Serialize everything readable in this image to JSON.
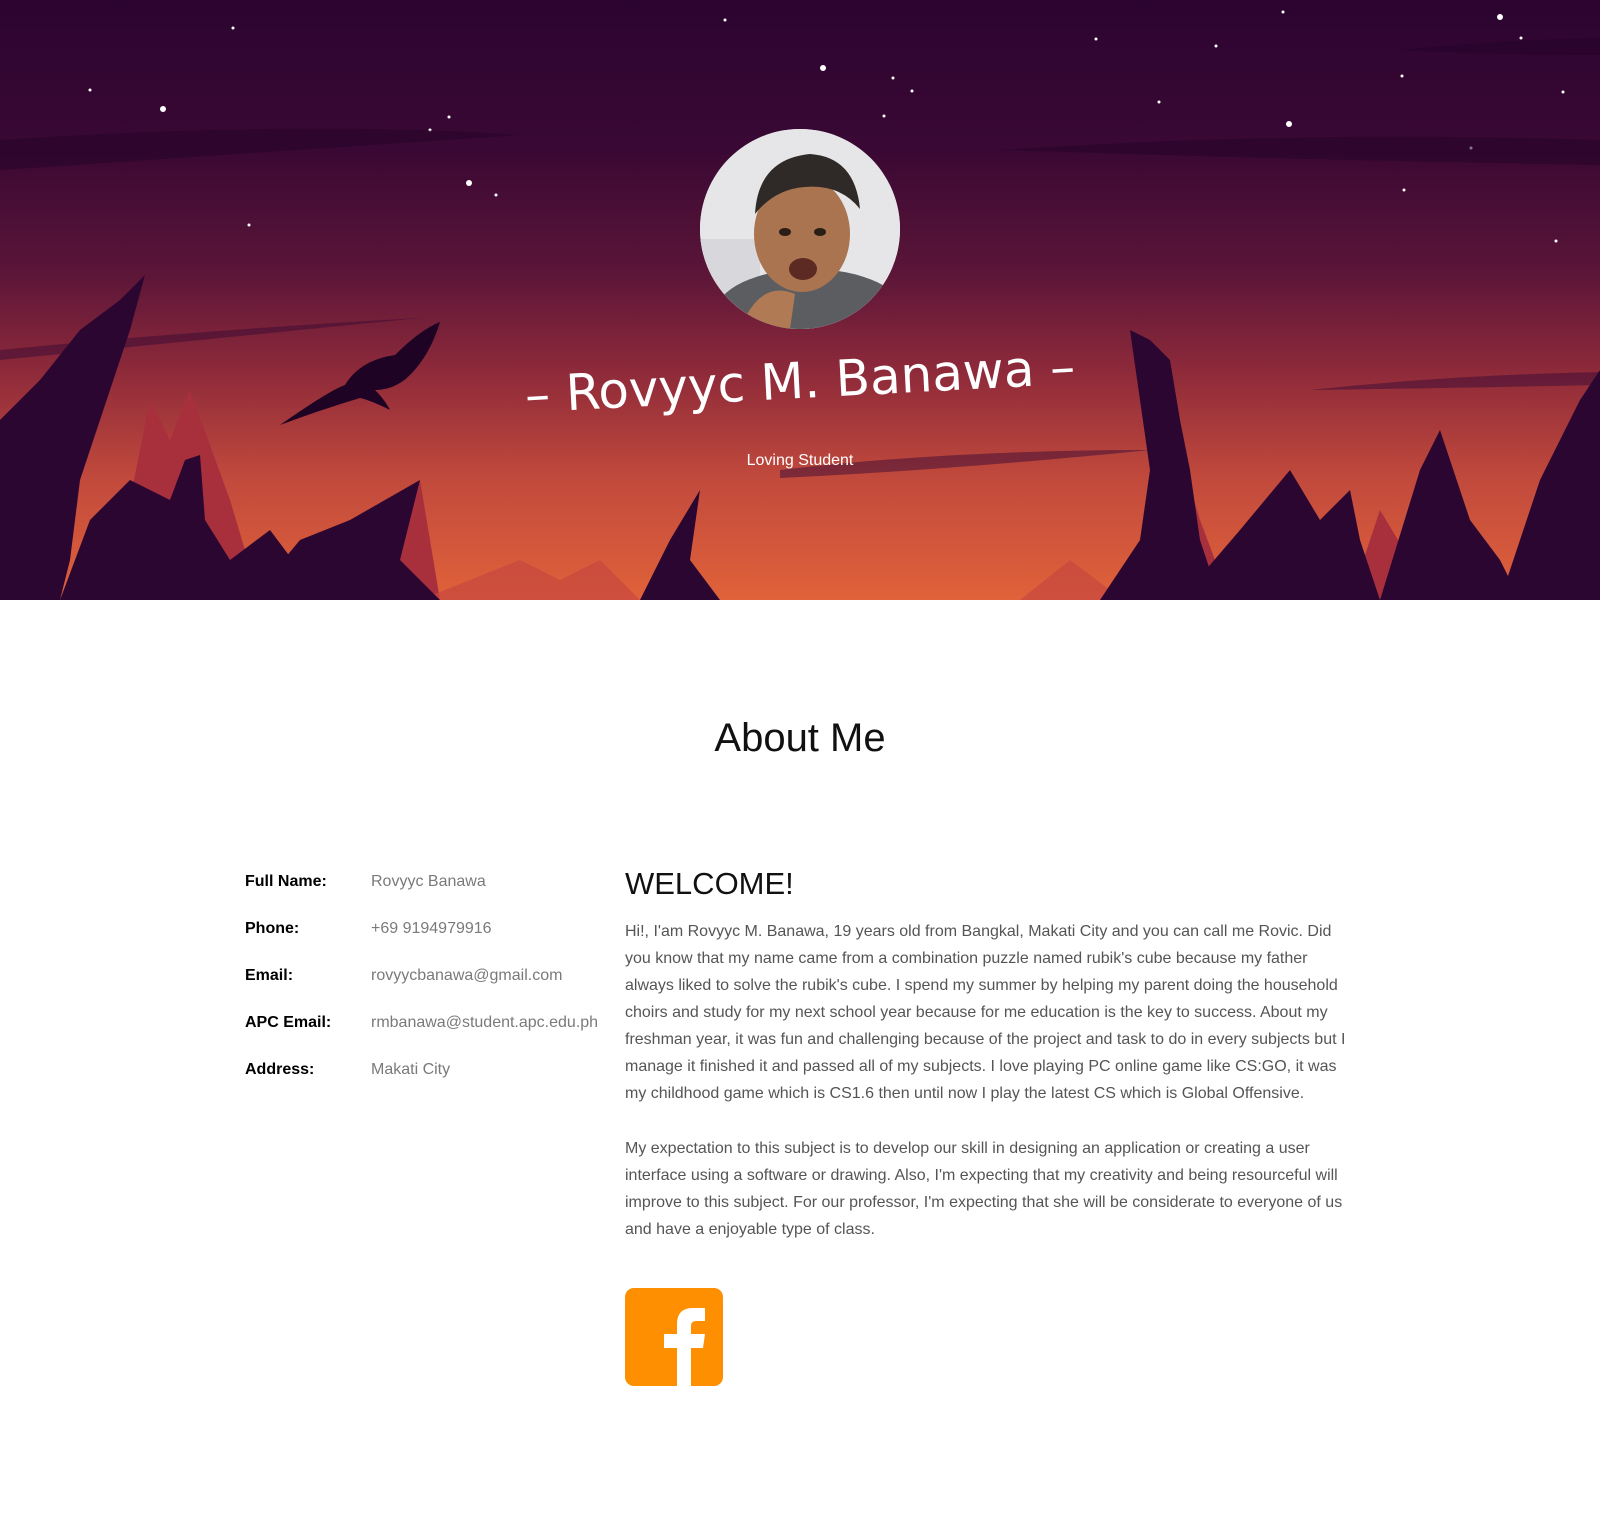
{
  "hero": {
    "name": "– Rovyyc M. Banawa –",
    "tagline": "Loving Student"
  },
  "about": {
    "title": "About Me",
    "info": [
      {
        "label": "Full Name:",
        "value": "Rovyyc Banawa"
      },
      {
        "label": "Phone:",
        "value": "+69 9194979916"
      },
      {
        "label": "Email:",
        "value": "rovyycbanawa@gmail.com"
      },
      {
        "label": "APC Email:",
        "value": "rmbanawa@student.apc.edu.ph"
      },
      {
        "label": "Address:",
        "value": "Makati City"
      }
    ],
    "welcome_heading": "WELCOME!",
    "paragraphs": [
      "Hi!, I'am Rovyyc M. Banawa, 19 years old from Bangkal, Makati City and you can call me Rovic. Did you know that my name came from a combination puzzle named rubik's cube because my father always liked to solve the rubik's cube. I spend my summer by helping my parent doing the household choirs and study for my next school year because for me education is the key to success. About my freshman year, it was fun and challenging because of the project and task to do in every subjects but I manage it finished it and passed all of my subjects. I love playing PC online game like CS:GO, it was my childhood game which is CS1.6 then until now I play the latest CS which is Global Offensive.",
      "My expectation to this subject is to develop our skill in designing an application or creating a user interface using a software or drawing. Also, I'm expecting that my creativity and being resourceful will improve to this subject. For our professor, I'm expecting that she will be considerate to everyone of us and have a enjoyable type of class."
    ]
  },
  "social": {
    "icon": "facebook-icon",
    "color": "#fd8f00"
  },
  "colors": {
    "sky_top": "#2c0430",
    "sky_bottom": "#e0623a",
    "mountain": "#2b0631"
  }
}
